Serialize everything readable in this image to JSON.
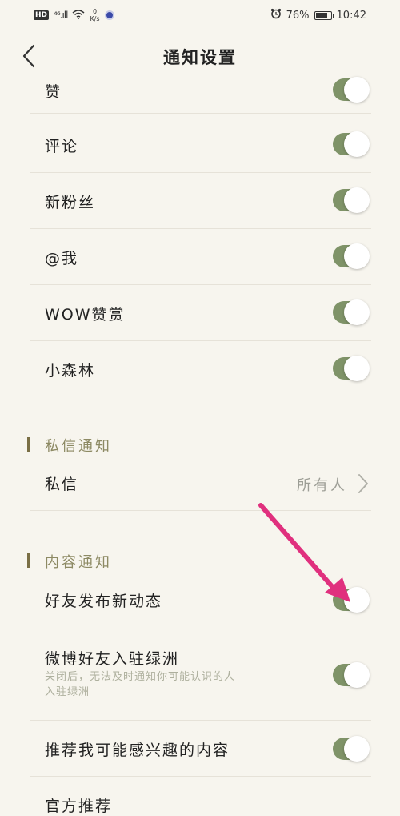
{
  "status_bar": {
    "network_badge": "HD",
    "signal": "⁴⁶.ıll",
    "speed_value": "0",
    "speed_unit": "K/s",
    "battery_text": "76%",
    "time": "10:42"
  },
  "header": {
    "title": "通知设置"
  },
  "interaction_items": [
    {
      "label": "赞",
      "toggle_on": true
    },
    {
      "label": "评论",
      "toggle_on": true
    },
    {
      "label": "新粉丝",
      "toggle_on": true
    },
    {
      "label": "@我",
      "toggle_on": true
    },
    {
      "label": "WOW赞赏",
      "toggle_on": true
    },
    {
      "label": "小森林",
      "toggle_on": true
    }
  ],
  "private_section": {
    "title": "私信通知",
    "item_label": "私信",
    "item_value": "所有人"
  },
  "content_section": {
    "title": "内容通知",
    "items": [
      {
        "label": "好友发布新动态",
        "toggle_on": true
      },
      {
        "label": "微博好友入驻绿洲",
        "sub_line1": "关闭后，无法及时通知你可能认识的人",
        "sub_line2": "入驻绿洲",
        "toggle_on": true
      },
      {
        "label": "推荐我可能感兴趣的内容",
        "toggle_on": true
      },
      {
        "label": "官方推荐",
        "toggle_on": true
      }
    ]
  },
  "colors": {
    "toggle_on": "#7f9368",
    "section_bar": "#7a6f45",
    "annotation_arrow": "#e0307e",
    "background": "#f7f5ee"
  }
}
